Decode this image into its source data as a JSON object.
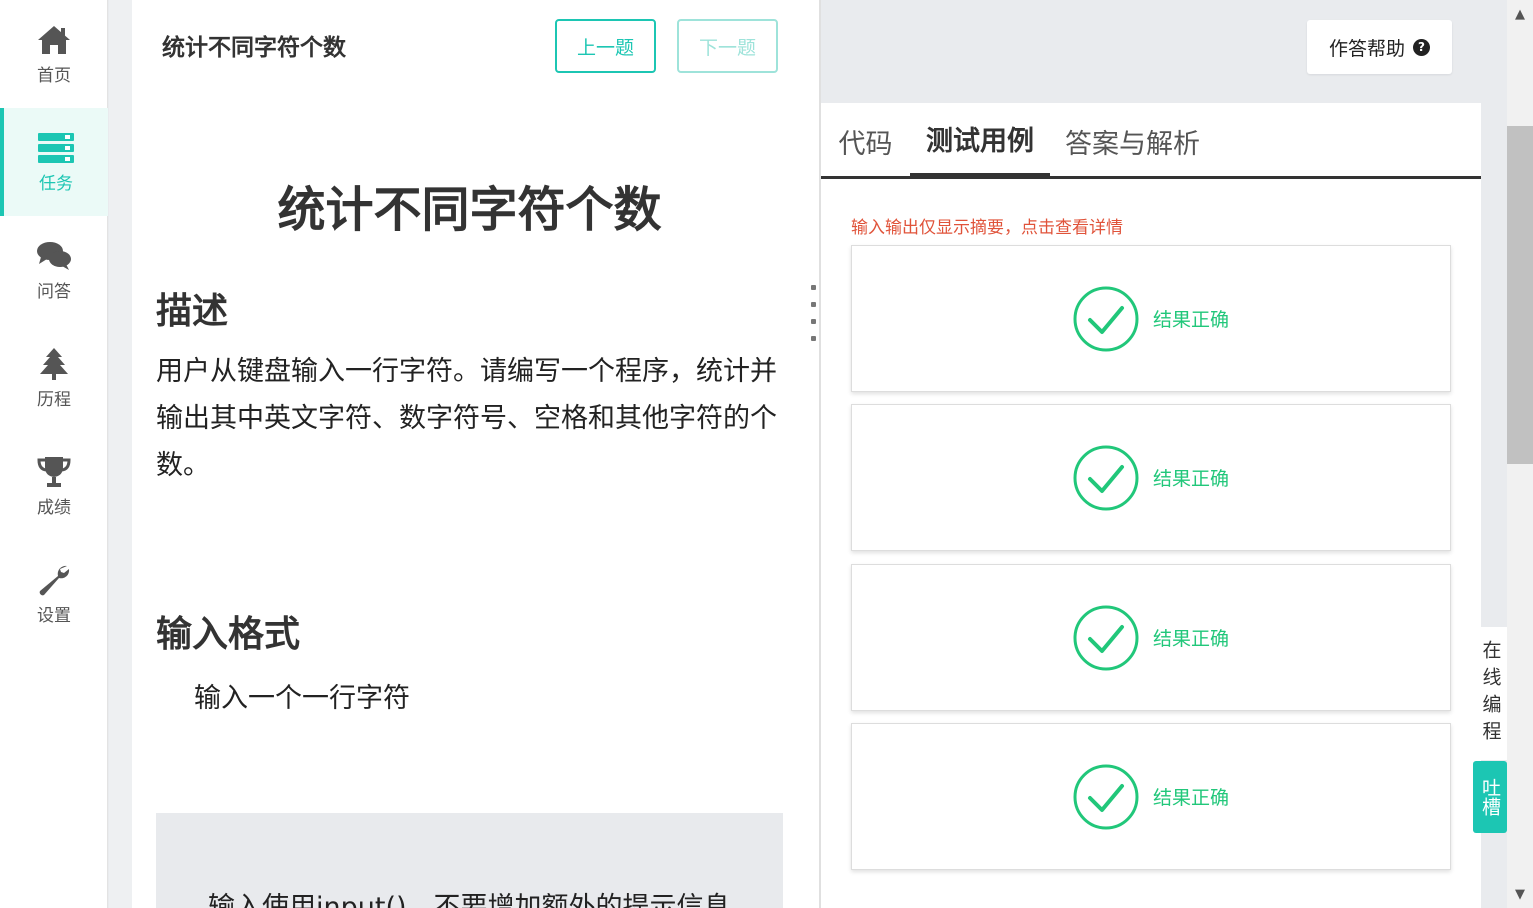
{
  "nav": [
    {
      "label": "首页",
      "icon": "home-icon"
    },
    {
      "label": "任务",
      "icon": "tasks-icon",
      "active": true
    },
    {
      "label": "问答",
      "icon": "chat-icon"
    },
    {
      "label": "历程",
      "icon": "tree-icon"
    },
    {
      "label": "成绩",
      "icon": "trophy-icon"
    },
    {
      "label": "设置",
      "icon": "wrench-icon"
    }
  ],
  "problem": {
    "top_title": "统计不同字符个数",
    "prev_label": "上一题",
    "next_label": "下一题",
    "heading": "统计不同字符个数",
    "desc_heading": "描述",
    "description": "用户从键盘输入一行字符。请编写一个程序，统计并输出其中英文字符、数字符号、空格和其他字符的个数。",
    "input_heading": "输入格式",
    "input_text": "输入一个一行字符",
    "code_note": "输入使用input()，不要增加额外的提示信息"
  },
  "help": {
    "label": "作答帮助",
    "icon": "question-circle-icon"
  },
  "tabs": [
    {
      "label": "代码"
    },
    {
      "label": "测试用例",
      "active": true
    },
    {
      "label": "答案与解析"
    }
  ],
  "notice": "输入输出仅显示摘要，点击查看详情",
  "cases": [
    {
      "result": "结果正确"
    },
    {
      "result": "结果正确"
    },
    {
      "result": "结果正确"
    },
    {
      "result": "结果正确"
    }
  ],
  "float_tab": "在线编程",
  "feedback_tab": "吐槽",
  "colors": {
    "accent": "#1cc6b3",
    "success": "#21c77a",
    "notice": "#e0533a"
  }
}
